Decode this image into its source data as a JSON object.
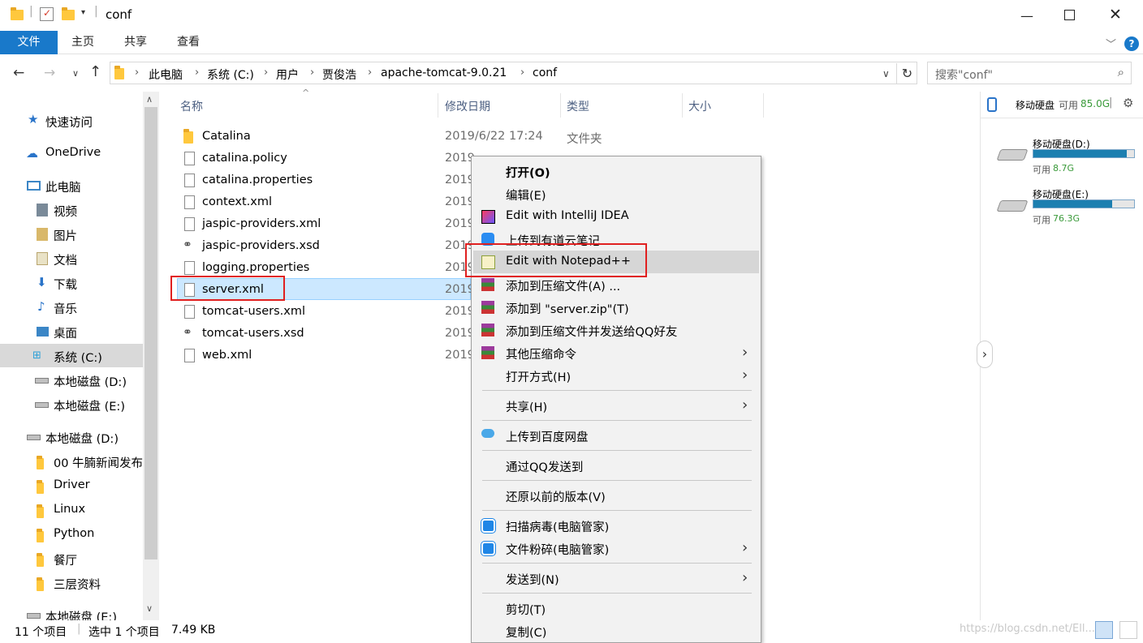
{
  "window": {
    "title": "conf"
  },
  "ribbon": {
    "file_tab": "文件",
    "tabs": [
      "主页",
      "共享",
      "查看"
    ]
  },
  "address": {
    "crumbs": [
      "此电脑",
      "系统 (C:)",
      "用户",
      "贾俊浩",
      "apache-tomcat-9.0.21",
      "conf"
    ],
    "search_placeholder": "搜索\"conf\""
  },
  "nav": {
    "quick_access": "快速访问",
    "onedrive": "OneDrive",
    "this_pc": "此电脑",
    "pc_items": [
      "视频",
      "图片",
      "文档",
      "下载",
      "音乐",
      "桌面",
      "系统 (C:)",
      "本地磁盘 (D:)",
      "本地磁盘 (E:)"
    ],
    "drive_d": "本地磁盘 (D:)",
    "d_items": [
      "00 牛腩新闻发布",
      "Driver",
      "Linux",
      "Python",
      "餐厅",
      "三层资料"
    ],
    "drive_e_partial": "本地磁盘 (E:)"
  },
  "columns": {
    "name": "名称",
    "date": "修改日期",
    "type": "类型",
    "size": "大小"
  },
  "files": [
    {
      "name": "Catalina",
      "date": "2019/6/22 17:24",
      "type": "文件夹",
      "icon": "folder"
    },
    {
      "name": "catalina.policy",
      "date": "2019",
      "type": "",
      "icon": "file"
    },
    {
      "name": "catalina.properties",
      "date": "2019",
      "type": "",
      "icon": "file"
    },
    {
      "name": "context.xml",
      "date": "2019",
      "type": "",
      "icon": "file"
    },
    {
      "name": "jaspic-providers.xml",
      "date": "2019",
      "type": "",
      "icon": "file"
    },
    {
      "name": "jaspic-providers.xsd",
      "date": "2019",
      "type": "",
      "icon": "xsd"
    },
    {
      "name": "logging.properties",
      "date": "2019",
      "type": "",
      "icon": "file"
    },
    {
      "name": "server.xml",
      "date": "2019",
      "type": "",
      "icon": "file"
    },
    {
      "name": "tomcat-users.xml",
      "date": "2019",
      "type": "",
      "icon": "file"
    },
    {
      "name": "tomcat-users.xsd",
      "date": "2019",
      "type": "",
      "icon": "xsd"
    },
    {
      "name": "web.xml",
      "date": "2019",
      "type": "",
      "icon": "file"
    }
  ],
  "context_menu": {
    "items": [
      {
        "label": "打开(O)",
        "bold": true
      },
      {
        "label": "编辑(E)"
      },
      {
        "label": "Edit with IntelliJ IDEA",
        "icon": "intellij-icon"
      },
      {
        "label": "上传到有道云笔记",
        "icon": "youdao-icon"
      },
      {
        "label": "Edit with Notepad++",
        "icon": "notepad-plus-plus-icon",
        "highlighted": true
      },
      {
        "label": "添加到压缩文件(A) ...",
        "icon": "winrar-icon"
      },
      {
        "label": "添加到 \"server.zip\"(T)",
        "icon": "winrar-icon"
      },
      {
        "label": "添加到压缩文件并发送给QQ好友",
        "icon": "winrar-icon"
      },
      {
        "label": "其他压缩命令",
        "icon": "winrar-icon",
        "submenu": true
      },
      {
        "label": "打开方式(H)",
        "submenu": true
      },
      {
        "label": "共享(H)",
        "submenu": true
      },
      {
        "label": "上传到百度网盘",
        "icon": "baidu-netdisk-icon"
      },
      {
        "label": "通过QQ发送到"
      },
      {
        "label": "还原以前的版本(V)"
      },
      {
        "label": "扫描病毒(电脑管家)",
        "icon": "tencent-pc-manager-icon"
      },
      {
        "label": "文件粉碎(电脑管家)",
        "icon": "tencent-pc-manager-icon",
        "submenu": true
      },
      {
        "label": "发送到(N)",
        "submenu": true
      },
      {
        "label": "剪切(T)"
      },
      {
        "label": "复制(C)"
      }
    ]
  },
  "right_pane": {
    "header_label": "移动硬盘",
    "header_free": "可用",
    "header_free_value": "85.0G",
    "drives": [
      {
        "name": "移动硬盘(D:)",
        "free_label": "可用",
        "free_value": "8.7G",
        "used_fraction": 0.93
      },
      {
        "name": "移动硬盘(E:)",
        "free_label": "可用",
        "free_value": "76.3G",
        "used_fraction": 0.78
      }
    ]
  },
  "status": {
    "count": "11 个项目",
    "selected": "选中 1 个项目",
    "size": "7.49 KB"
  },
  "watermark": "https://blog.csdn.net/Ell...",
  "colors": {
    "accent": "#1979ca",
    "selection": "#cce8ff",
    "highlight_box": "#e02020",
    "free_space": "#3a9a3a"
  }
}
